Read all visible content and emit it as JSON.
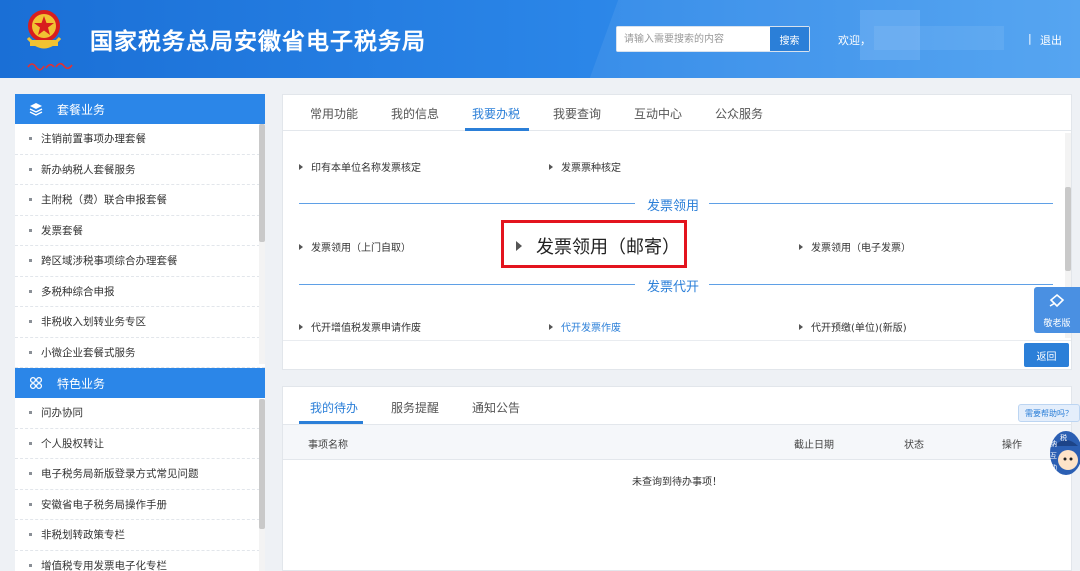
{
  "header": {
    "title": "国家税务总局安徽省电子税务局",
    "signature_text": "中国税务",
    "search_placeholder": "请输入需要搜索的内容",
    "search_button": "搜索",
    "welcome": "欢迎，",
    "logout_sep": "|",
    "logout": "退出"
  },
  "sidebar": {
    "section1": {
      "title": "套餐业务",
      "icon": "layers-icon",
      "items": [
        "注销前置事项办理套餐",
        "新办纳税人套餐服务",
        "主附税（费）联合申报套餐",
        "发票套餐",
        "跨区域涉税事项综合办理套餐",
        "多税种综合申报",
        "非税收入划转业务专区",
        "小微企业套餐式服务"
      ]
    },
    "section2": {
      "title": "特色业务",
      "icon": "grid-icon",
      "items": [
        "问办协同",
        "个人股权转让",
        "电子税务局新版登录方式常见问题",
        "安徽省电子税务局操作手册",
        "非税划转政策专栏",
        "增值税专用发票电子化专栏"
      ]
    },
    "scrollbar": {
      "position": 0.0,
      "visible_fraction": 0.25
    }
  },
  "main": {
    "tabs": [
      "常用功能",
      "我的信息",
      "我要办税",
      "我要查询",
      "互动中心",
      "公众服务"
    ],
    "active_tab": "我要办税",
    "row1": [
      "印有本单位名称发票核定",
      "发票票种核定"
    ],
    "section_invoice_receive": "发票领用",
    "row2": [
      "发票领用（上门自取）",
      "发票领用（邮寄）",
      "发票领用（电子发票）"
    ],
    "section_invoice_issue": "发票代开",
    "row3": [
      "代开增值税发票申请作废",
      "代开发票作废",
      "代开预缴(单位)(新版)"
    ],
    "back_button": "返回"
  },
  "todo": {
    "tabs": [
      "我的待办",
      "服务提醒",
      "通知公告"
    ],
    "active_tab": "我的待办",
    "columns": [
      "事项名称",
      "截止日期",
      "状态",
      "操作"
    ],
    "empty_message": "未查询到待办事项！"
  },
  "floating": {
    "elderly_label": "敬老版",
    "help_label": "需要帮助吗？",
    "mascot_text": "纳税互动"
  },
  "colors": {
    "primary": "#2b7fd8",
    "header": "#1a6fd6",
    "highlight_border": "#e3141e",
    "sidebar_header": "#2b86e8"
  }
}
